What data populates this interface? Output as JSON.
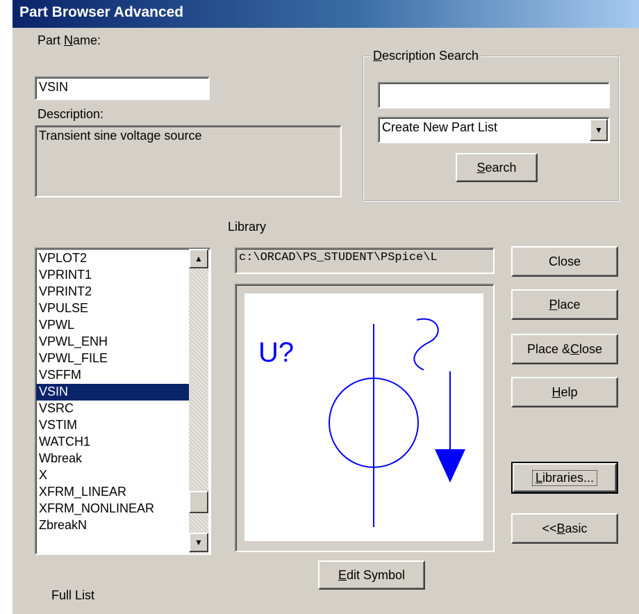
{
  "window": {
    "title": "Part Browser Advanced"
  },
  "part_name": {
    "label_pre": "Part ",
    "label_key": "N",
    "label_post": "ame:",
    "value": "VSIN"
  },
  "description": {
    "label": "Description:",
    "value": "Transient sine voltage source"
  },
  "description_search": {
    "label_key": "D",
    "label_post": "escription Search",
    "input_value": "",
    "dropdown_selected": "Create New Part List",
    "search_button_key": "S",
    "search_button_post": "earch"
  },
  "library": {
    "label": "Library",
    "path": "c:\\ORCAD\\PS_STUDENT\\PSpice\\L"
  },
  "parts_list": {
    "items": [
      "VPLOT2",
      "VPRINT1",
      "VPRINT2",
      "VPULSE",
      "VPWL",
      "VPWL_ENH",
      "VPWL_FILE",
      "VSFFM",
      "VSIN",
      "VSRC",
      "VSTIM",
      "WATCH1",
      "Wbreak",
      "X",
      "XFRM_LINEAR",
      "XFRM_NONLINEAR",
      "ZbreakN"
    ],
    "selected": "VSIN",
    "scroll_position_fraction": 0.92
  },
  "symbol_preview": {
    "ref_label": "U?",
    "stroke_color": "#0000ff"
  },
  "buttons": {
    "close": "Close",
    "place_key": "P",
    "place_post": "lace",
    "place_close_pre": "Place & ",
    "place_close_key": "C",
    "place_close_post": "lose",
    "help_key": "H",
    "help_post": "elp",
    "libraries_key": "L",
    "libraries_post": "ibraries...",
    "basic_pre": "<< ",
    "basic_key": "B",
    "basic_post": "asic",
    "edit_symbol_key": "E",
    "edit_symbol_post": "dit Symbol"
  },
  "footer": {
    "list_mode": "Full List"
  }
}
